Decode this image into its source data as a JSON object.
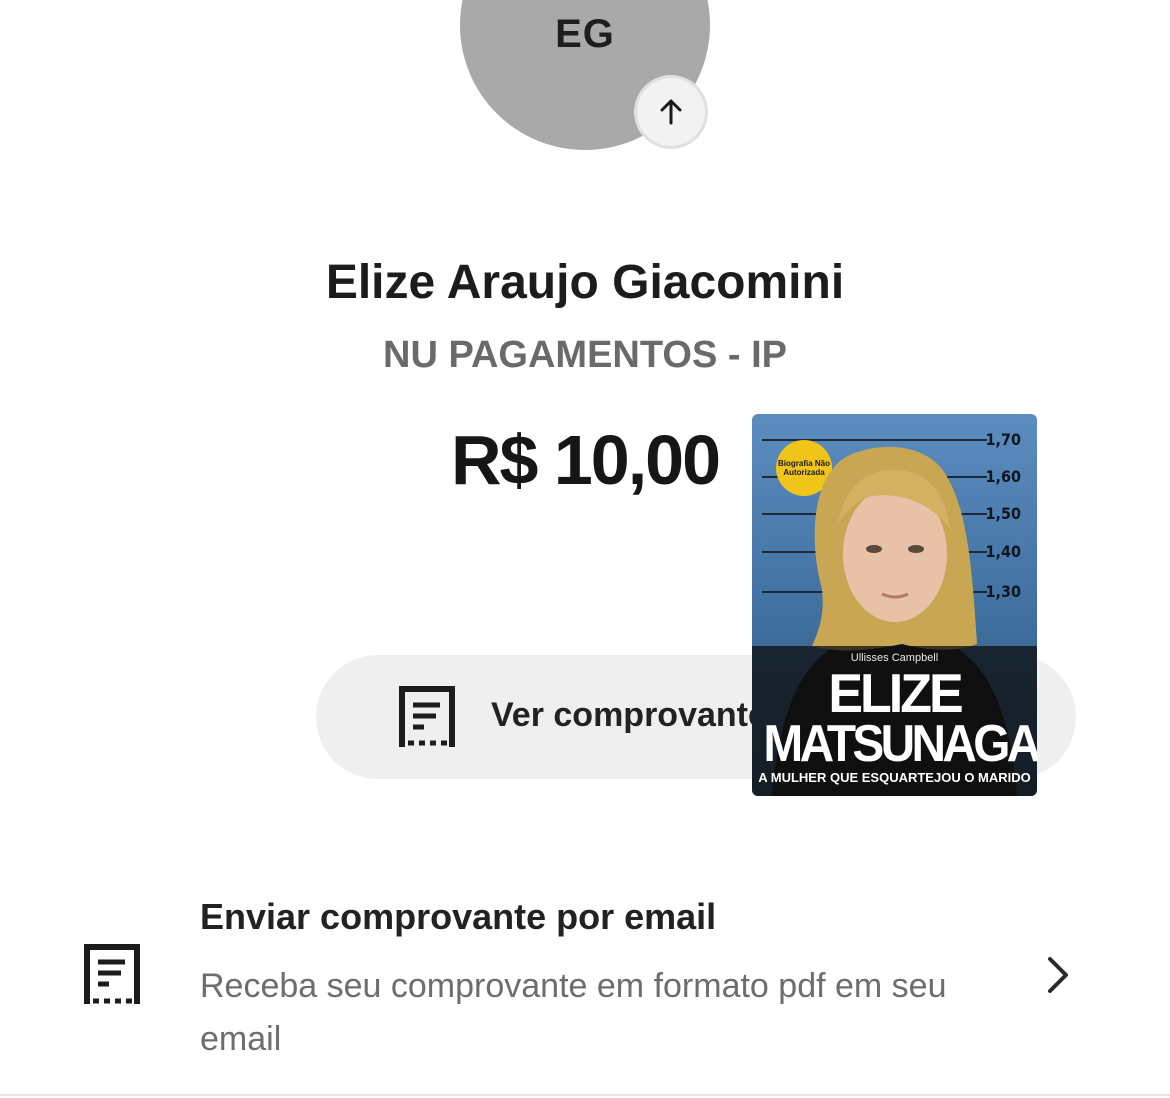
{
  "recipient": {
    "initials": "EG",
    "name": "Elize Araujo Giacomini",
    "institution": "NU PAGAMENTOS - IP"
  },
  "transfer": {
    "amount": "R$ 10,00"
  },
  "receipt_button": {
    "label": "Ver comprovante"
  },
  "email_receipt": {
    "title": "Enviar comprovante por email",
    "description": "Receba seu comprovante em formato pdf em seu email"
  },
  "book_cover": {
    "author": "Ullisses Campbell",
    "title_line1": "ELIZE",
    "title_line2": "MATSUNAGA",
    "subtitle": "A MULHER QUE ESQUARTEJOU O MARIDO",
    "seal": "Biografia Não Autorizada",
    "height_marks": [
      "1,70",
      "1,60",
      "1,50",
      "1,40",
      "1,30"
    ]
  },
  "icons": {
    "avatar_badge": "arrow-up-icon",
    "receipt": "receipt-icon",
    "chevron": "chevron-right-icon"
  }
}
